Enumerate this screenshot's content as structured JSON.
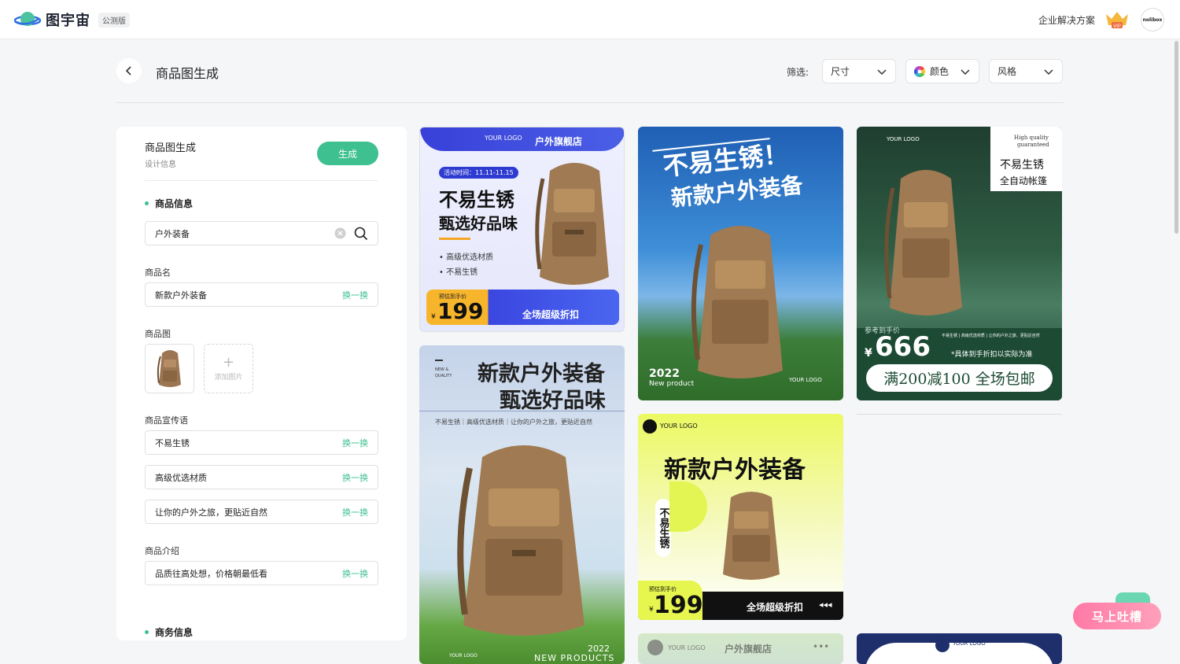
{
  "header": {
    "logo_text": "图宇宙",
    "beta_badge": "公测版",
    "enterprise_link": "企业解决方案",
    "vip_label": "VIP",
    "avatar_text": "nolibox"
  },
  "toolbar": {
    "page_title": "商品图生成",
    "filter_label": "筛选:",
    "filters": [
      "尺寸",
      "颜色",
      "风格"
    ]
  },
  "form": {
    "title": "商品图生成",
    "subtitle": "设计信息",
    "generate_label": "生成",
    "section_product": "商品信息",
    "search_value": "户外装备",
    "name_label": "商品名",
    "name_value": "新款户外装备",
    "swap_label": "换一换",
    "image_label": "商品图",
    "add_image_label": "添加图片",
    "slogan_label": "商品宣传语",
    "slogans": [
      "不易生锈",
      "高级优选材质",
      "让你的户外之旅，更贴近自然"
    ],
    "intro_label": "商品介绍",
    "intro_value": "品质往高处想，价格朝最低看",
    "section_business": "商务信息"
  },
  "cards": {
    "c1": {
      "logo": "YOUR LOGO",
      "store": "户外旗舰店",
      "activity": "活动时间：11.11-11.15",
      "headline1": "不易生锈",
      "headline2": "甄选好品味",
      "bullet1": "高级优选材质",
      "bullet2": "不易生锈",
      "price_tag": "预估到手价",
      "currency": "¥",
      "price": "199",
      "promo": "全场超级折扣"
    },
    "c2": {
      "headline1": "不易生锈！",
      "headline2": "新款户外装备",
      "year": "2022",
      "sub": "New product",
      "logo": "YOUR LOGO"
    },
    "c3": {
      "logo": "YOUR LOGO",
      "quality1": "High quality",
      "quality2": "guaranteed",
      "tag1": "不易生锈",
      "tag2": "全自动帐篷",
      "price_label": "参考到手价",
      "currency": "¥",
      "price": "666",
      "mini_text": "不易生锈 | 高级优选材质 | 让你的户外之旅，更贴近自然",
      "note": "*具体到手折扣以实际为准",
      "banner": "满200减100 全场包邮"
    },
    "c4": {
      "corner1": "NEW &",
      "corner2": "QUALITY",
      "headline1": "新款户外装备",
      "headline2": "甄选好品味",
      "sub": "不易生锈｜高级优选材质｜让你的户外之旅，更贴近自然",
      "logo": "YOUR LOGO",
      "year": "2022",
      "footer": "NEW PRODUCTS"
    },
    "c5": {
      "logo": "YOUR LOGO",
      "headline": "新款户外装备",
      "vertical": "不易生锈",
      "price_tag": "预估到手价",
      "currency": "¥",
      "price": "199",
      "promo": "全场超级折扣"
    },
    "c6": {
      "logo": "YOUR LOGO",
      "store": "户外旗舰店"
    },
    "c7": {
      "logo": "YOUR LOGO"
    }
  },
  "feedback_label": "马上吐槽"
}
